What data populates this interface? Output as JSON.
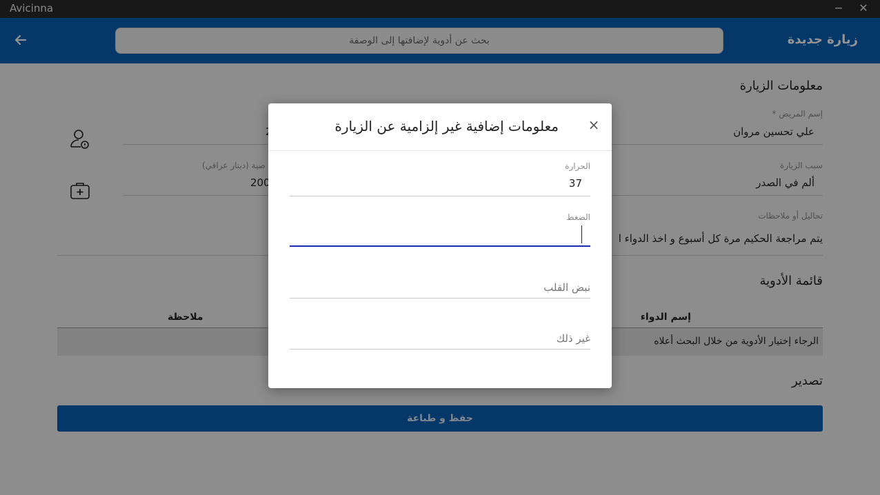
{
  "window": {
    "app_name": "Avicinna",
    "minimize": "−",
    "close": "✕"
  },
  "header": {
    "title": "زيارة جديدة",
    "search_placeholder": "بحث عن أدوية لإضافتها إلى الوصفة"
  },
  "visit_info": {
    "section_title": "معلومات الزيارة",
    "patient_name_label": "إسم المريض *",
    "patient_name": "علي تحسين مروان",
    "visit_reason_label": "سبب الزيارة",
    "visit_reason": "ألم في الصدر",
    "fee_label": "صية (دينار عراقي)",
    "fee_value": "200",
    "age_value": "2",
    "notes_label": "تحاليل أو ملاحظات",
    "notes_value": "يتم مراجعة الحكيم مرة كل أسبوع و اخذ الدواء ا"
  },
  "medications": {
    "section_title": "قائمة الأدوية",
    "columns": [
      "إسم الدواء",
      "ملاحظة"
    ],
    "empty_hint": "الرجاء إختيار الأدوية من خلال البحث أعلاه"
  },
  "export": {
    "section_title": "تصدير",
    "save_print_label": "حفظ و طباعة"
  },
  "modal": {
    "title": "معلومات إضافية غير إلزامية عن الزيارة",
    "close_glyph": "×",
    "fields": {
      "temperature": {
        "label": "الحرارة",
        "value": "37"
      },
      "pressure": {
        "label": "الضغط",
        "value": ""
      },
      "heart_rate": {
        "placeholder": "نبض القلب"
      },
      "other": {
        "placeholder": "غير ذلك"
      }
    }
  },
  "colors": {
    "primary": "#0a5fb4",
    "focus_underline": "#1a2cb0"
  }
}
